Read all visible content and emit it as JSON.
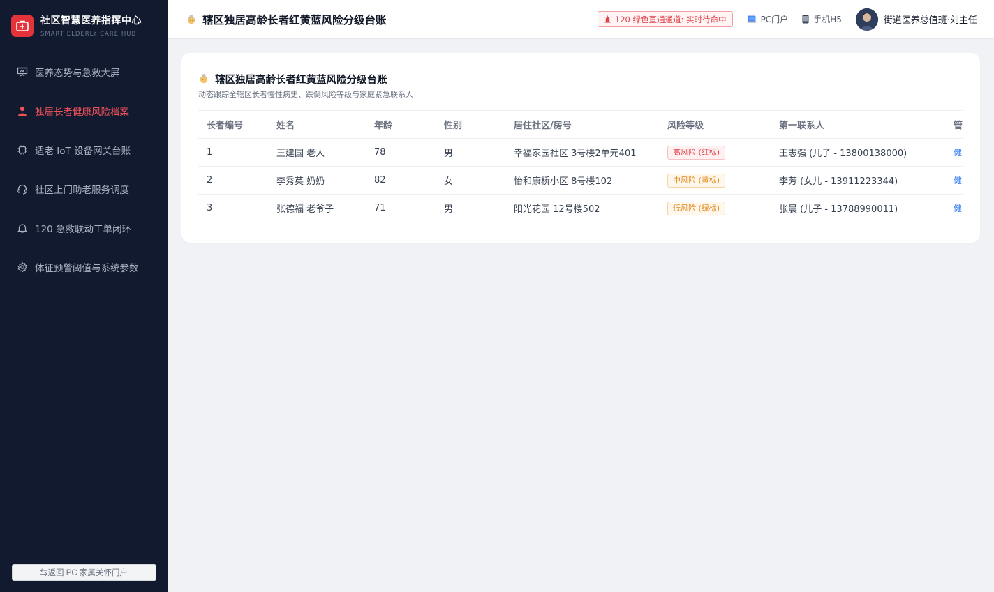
{
  "brand": {
    "title": "社区智慧医养指挥中心",
    "subtitle": "SMART ELDERLY CARE HUB"
  },
  "nav": [
    {
      "label": "医养态势与急救大屏",
      "icon": "presentation-icon",
      "active": false
    },
    {
      "label": "独居长者健康风险档案",
      "icon": "user-icon",
      "active": true
    },
    {
      "label": "适老 IoT 设备网关台账",
      "icon": "chip-icon",
      "active": false
    },
    {
      "label": "社区上门助老服务调度",
      "icon": "headset-icon",
      "active": false
    },
    {
      "label": "120 急救联动工单闭环",
      "icon": "bell-icon",
      "active": false
    },
    {
      "label": "体征预警阈值与系统参数",
      "icon": "gear-icon",
      "active": false
    }
  ],
  "footer": {
    "back_label": "⇆返回 PC 家属关怀门户"
  },
  "header": {
    "title": "辖区独居高龄长者红黄蓝风险分级台账",
    "status": "120 绿色直通通道: 实时待命中",
    "pc_link": "PC门户",
    "mobile_link": "手机H5",
    "user_name": "街道医养总值班·刘主任"
  },
  "card": {
    "title": "辖区独居高龄长者红黄蓝风险分级台账",
    "subtitle": "动态跟踪全辖区长者慢性病史、跌倒风险等级与家庭紧急联系人"
  },
  "table": {
    "columns": [
      "长者编号",
      "姓名",
      "年龄",
      "性别",
      "居住社区/房号",
      "风险等级",
      "第一联系人",
      "管"
    ],
    "rows": [
      {
        "id": "1",
        "name": "王建国 老人",
        "age": "78",
        "gender": "男",
        "address": "幸福家园社区 3号楼2单元401",
        "risk": "高风险 (红标)",
        "risk_level": "red",
        "contact": "王志强 (儿子 - 13800138000)",
        "op": "健"
      },
      {
        "id": "2",
        "name": "李秀英 奶奶",
        "age": "82",
        "gender": "女",
        "address": "怡和康桥小区 8号楼102",
        "risk": "中风险 (黄标)",
        "risk_level": "yellow",
        "contact": "李芳 (女儿 - 13911223344)",
        "op": "健"
      },
      {
        "id": "3",
        "name": "张德福 老爷子",
        "age": "71",
        "gender": "男",
        "address": "阳光花园 12号楼502",
        "risk": "低风险 (绿标)",
        "risk_level": "green",
        "contact": "张晨 (儿子 - 13788990011)",
        "op": "健"
      }
    ]
  },
  "colors": {
    "sidebar_bg": "#111a2e",
    "accent_red": "#e5333b",
    "active_nav": "#f0525a",
    "link_blue": "#3b82f6"
  }
}
